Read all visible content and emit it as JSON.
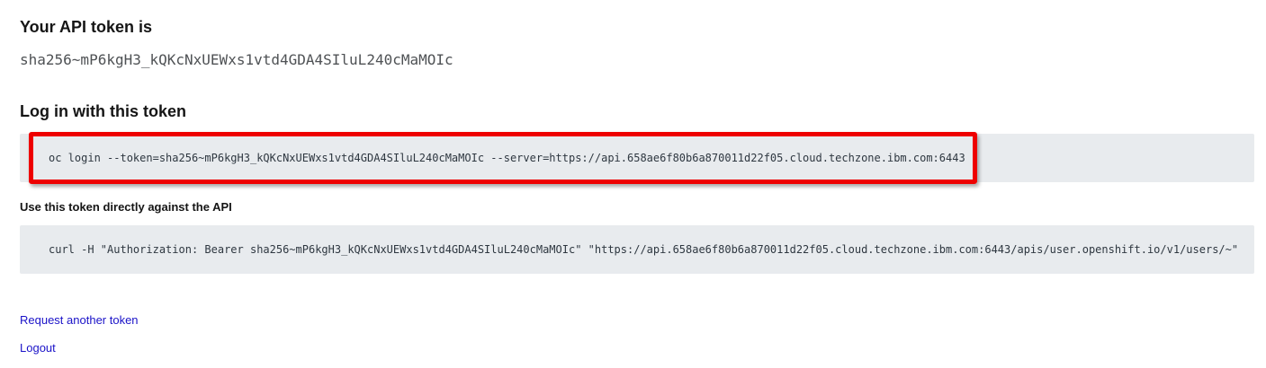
{
  "api_token": {
    "heading": "Your API token is",
    "value": "sha256~mP6kgH3_kQKcNxUEWxs1vtd4GDA4SIluL240cMaMOIc"
  },
  "login": {
    "heading": "Log in with this token",
    "command": "oc login --token=sha256~mP6kgH3_kQKcNxUEWxs1vtd4GDA4SIluL240cMaMOIc --server=https://api.658ae6f80b6a870011d22f05.cloud.techzone.ibm.com:6443",
    "highlight_color": "#ee0000"
  },
  "direct_api": {
    "heading": "Use this token directly against the API",
    "command": "curl -H \"Authorization: Bearer sha256~mP6kgH3_kQKcNxUEWxs1vtd4GDA4SIluL240cMaMOIc\" \"https://api.658ae6f80b6a870011d22f05.cloud.techzone.ibm.com:6443/apis/user.openshift.io/v1/users/~\""
  },
  "links": {
    "request_another": "Request another token",
    "logout": "Logout"
  }
}
